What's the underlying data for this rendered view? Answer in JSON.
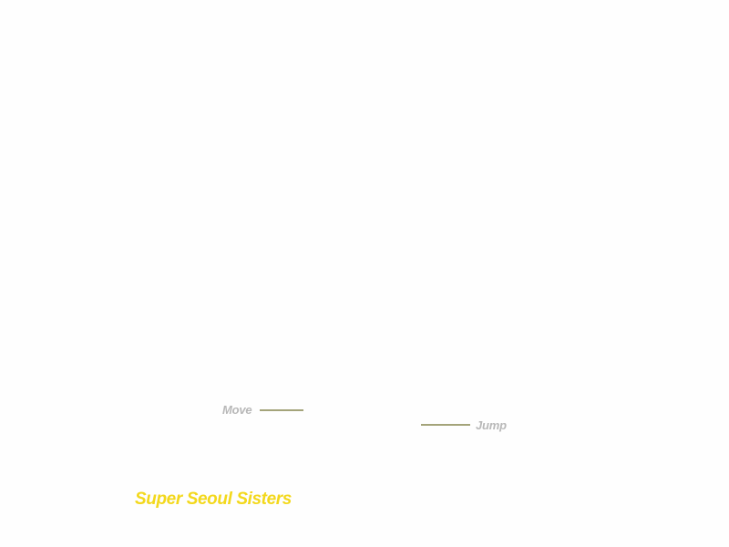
{
  "game": {
    "title": "Super Seoul Sisters",
    "title_color": "#f3d81c"
  },
  "controls": {
    "move_label": "Move",
    "jump_label": "Jump",
    "label_color": "#b8b8b8",
    "pointer_color": "#a4a47a"
  }
}
